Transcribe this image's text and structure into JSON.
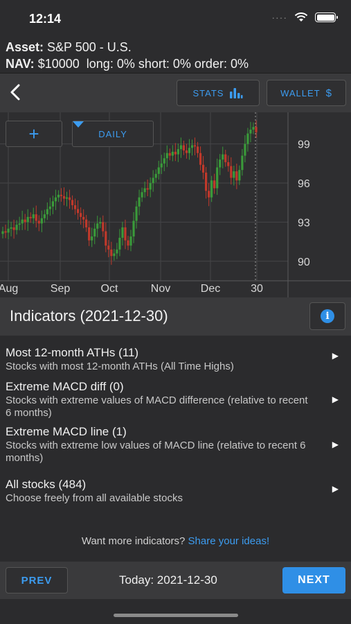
{
  "status": {
    "time": "12:14",
    "dots": "····"
  },
  "header": {
    "asset_label": "Asset:",
    "asset_value": "S&P 500 - U.S.",
    "nav_label": "NAV:",
    "nav_value": "$10000",
    "long": "long: 0%",
    "short": "short: 0%",
    "order": "order: 0%"
  },
  "toolbar": {
    "stats_label": "STATS",
    "wallet_label": "WALLET",
    "wallet_symbol": "$"
  },
  "chart_controls": {
    "add_symbol": "+",
    "period_label": "DAILY"
  },
  "chart_data": {
    "type": "candlestick",
    "x_labels": [
      "Aug",
      "Sep",
      "Oct",
      "Nov",
      "Dec",
      "30"
    ],
    "y_ticks": [
      90,
      93,
      96,
      99
    ],
    "ylim": [
      88.5,
      101
    ],
    "closes": [
      92.3,
      92.2,
      92.5,
      92.6,
      92.4,
      92.8,
      92.9,
      93.2,
      93.0,
      93.4,
      93.3,
      93.6,
      93.1,
      92.9,
      93.3,
      93.6,
      94.0,
      94.2,
      94.6,
      94.9,
      95.1,
      95.0,
      94.8,
      94.9,
      94.7,
      94.3,
      94.0,
      93.7,
      93.4,
      93.2,
      92.6,
      91.6,
      91.9,
      92.5,
      92.9,
      93.0,
      92.3,
      91.2,
      90.9,
      90.4,
      90.6,
      90.9,
      91.8,
      92.6,
      91.6,
      91.2,
      91.9,
      93.1,
      94.2,
      94.9,
      95.3,
      95.6,
      95.5,
      96.0,
      96.4,
      96.7,
      97.2,
      97.5,
      97.9,
      98.3,
      98.1,
      98.4,
      98.2,
      98.6,
      98.9,
      98.5,
      98.3,
      98.7,
      98.9,
      98.8,
      98.3,
      97.4,
      96.8,
      95.4,
      94.9,
      96.2,
      95.6,
      97.2,
      97.8,
      98.2,
      97.6,
      97.3,
      96.4,
      96.9,
      96.2,
      97.0,
      98.1,
      99.0,
      99.8,
      100.1,
      100.3,
      99.9
    ],
    "direction": "dark",
    "up_color": "#3a9a3a",
    "down_color": "#c0392b"
  },
  "indicators": {
    "title": "Indicators (2021-12-30)",
    "items": [
      {
        "title": "Most 12-month ATHs (11)",
        "desc": "Stocks with most 12-month ATHs (All Time Highs)"
      },
      {
        "title": "Extreme MACD diff (0)",
        "desc": "Stocks with extreme values of MACD difference (relative to recent 6 months)"
      },
      {
        "title": "Extreme MACD line (1)",
        "desc": "Stocks with extreme low values of MACD line (relative to recent 6 months)"
      },
      {
        "title": "All stocks (484)",
        "desc": "Choose freely from all available stocks"
      }
    ]
  },
  "footer": {
    "prompt": "Want more indicators?",
    "link": "Share your ideas!"
  },
  "bottom": {
    "prev": "PREV",
    "today": "Today: 2021-12-30",
    "next": "NEXT"
  },
  "colors": {
    "accent": "#2f8fe6",
    "link": "#3c9cf0"
  }
}
